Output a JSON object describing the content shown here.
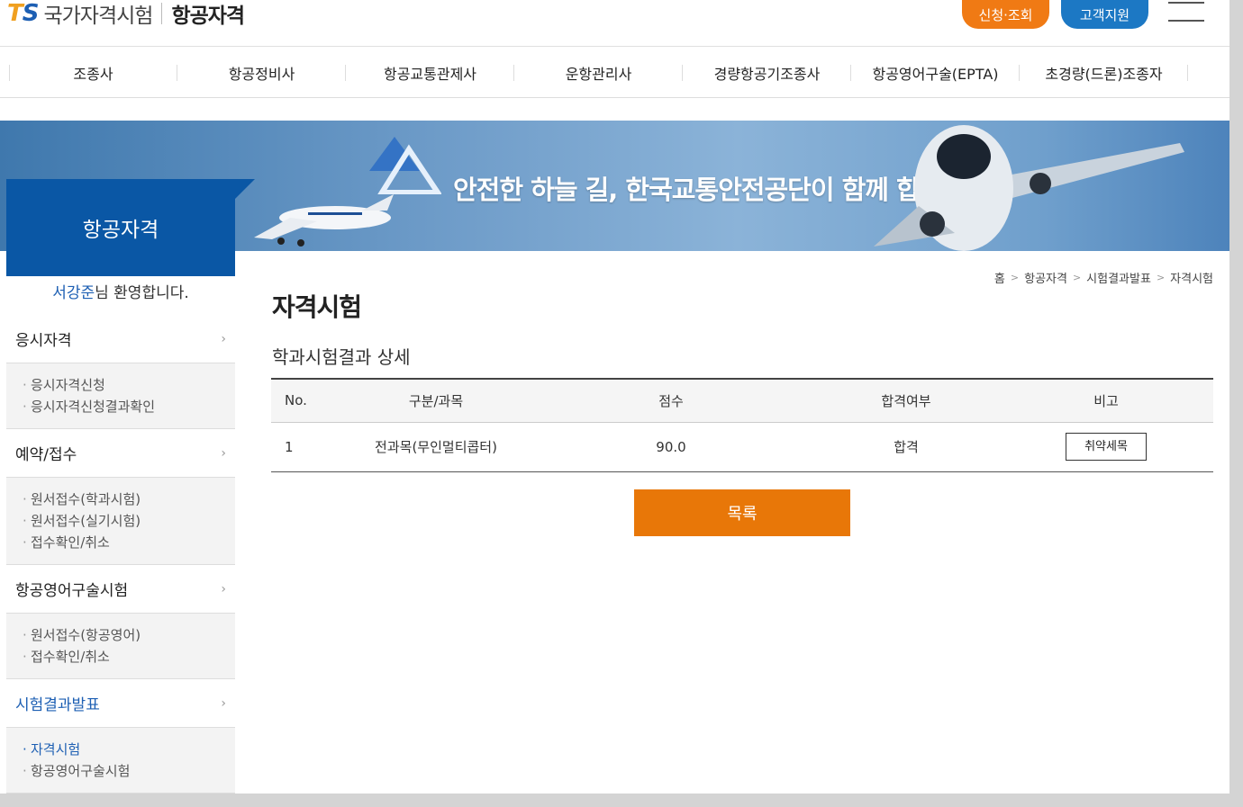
{
  "header": {
    "logo_mark": "TS",
    "logo_name": "국가자격시험",
    "logo_sub": "항공자격",
    "apply_button": "신청·조회",
    "support_button": "고객지원"
  },
  "gnb": [
    {
      "label": "조종사"
    },
    {
      "label": "항공정비사"
    },
    {
      "label": "항공교통관제사"
    },
    {
      "label": "운항관리사"
    },
    {
      "label": "경량항공기조종사"
    },
    {
      "label": "항공영어구술(EPTA)"
    },
    {
      "label": "초경량(드론)조종자"
    }
  ],
  "banner": {
    "slogan": "안전한 하늘 길, 한국교통안전공단이 함께 합니다"
  },
  "sidebar": {
    "title": "항공자격",
    "welcome_user": "서강준",
    "welcome_suffix": "님 환영합니다.",
    "sections": [
      {
        "label": "응시자격",
        "items": [
          "응시자격신청",
          "응시자격신청결과확인"
        ]
      },
      {
        "label": "예약/접수",
        "items": [
          "원서접수(학과시험)",
          "원서접수(실기시험)",
          "접수확인/취소"
        ]
      },
      {
        "label": "항공영어구술시험",
        "items": [
          "원서접수(항공영어)",
          "접수확인/취소"
        ]
      },
      {
        "label": "시험결과발표",
        "items": [
          "자격시험",
          "항공영어구술시험"
        ]
      }
    ]
  },
  "breadcrumb": [
    "홈",
    "항공자격",
    "시험결과발표",
    "자격시험"
  ],
  "content": {
    "title": "자격시험",
    "subtitle": "학과시험결과 상세",
    "table": {
      "headers": [
        "No.",
        "구분/과목",
        "점수",
        "합격여부",
        "비고"
      ],
      "rows": [
        {
          "no": "1",
          "subject": "전과목(무인멀티콥터)",
          "score": "90.0",
          "pass": "합격",
          "note_button": "취약세목"
        }
      ]
    },
    "list_button": "목록"
  },
  "colors": {
    "brand_blue": "#0a57a5",
    "accent_orange": "#e87708",
    "support_blue": "#1c78c4"
  }
}
